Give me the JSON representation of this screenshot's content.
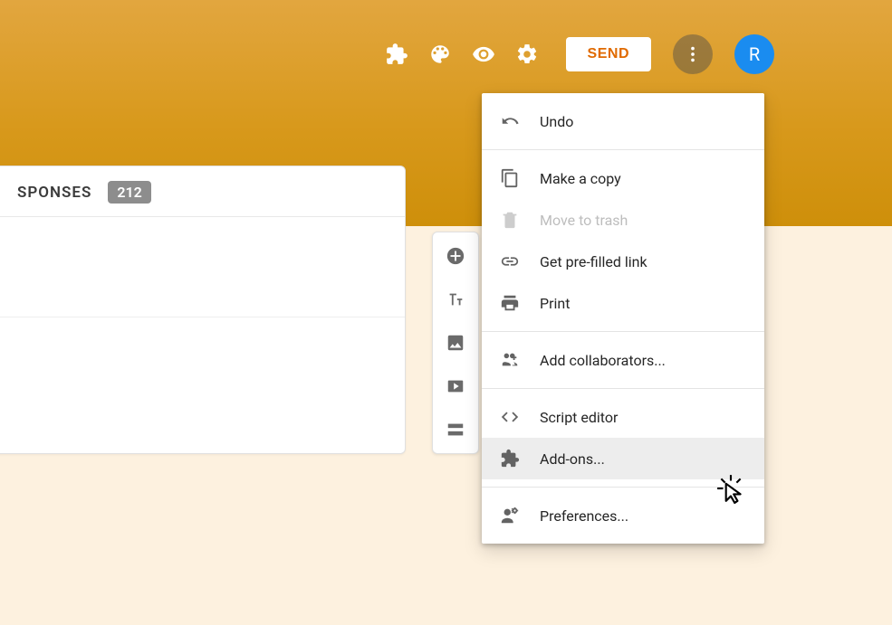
{
  "header": {
    "send_label": "SEND",
    "avatar_initial": "R"
  },
  "tabs": {
    "responses_label": "SPONSES",
    "responses_count": "212"
  },
  "menu": {
    "undo": "Undo",
    "make_copy": "Make a copy",
    "move_trash": "Move to trash",
    "prefilled": "Get pre-filled link",
    "print": "Print",
    "add_collab": "Add collaborators...",
    "script_editor": "Script editor",
    "addons": "Add-ons...",
    "preferences": "Preferences..."
  }
}
